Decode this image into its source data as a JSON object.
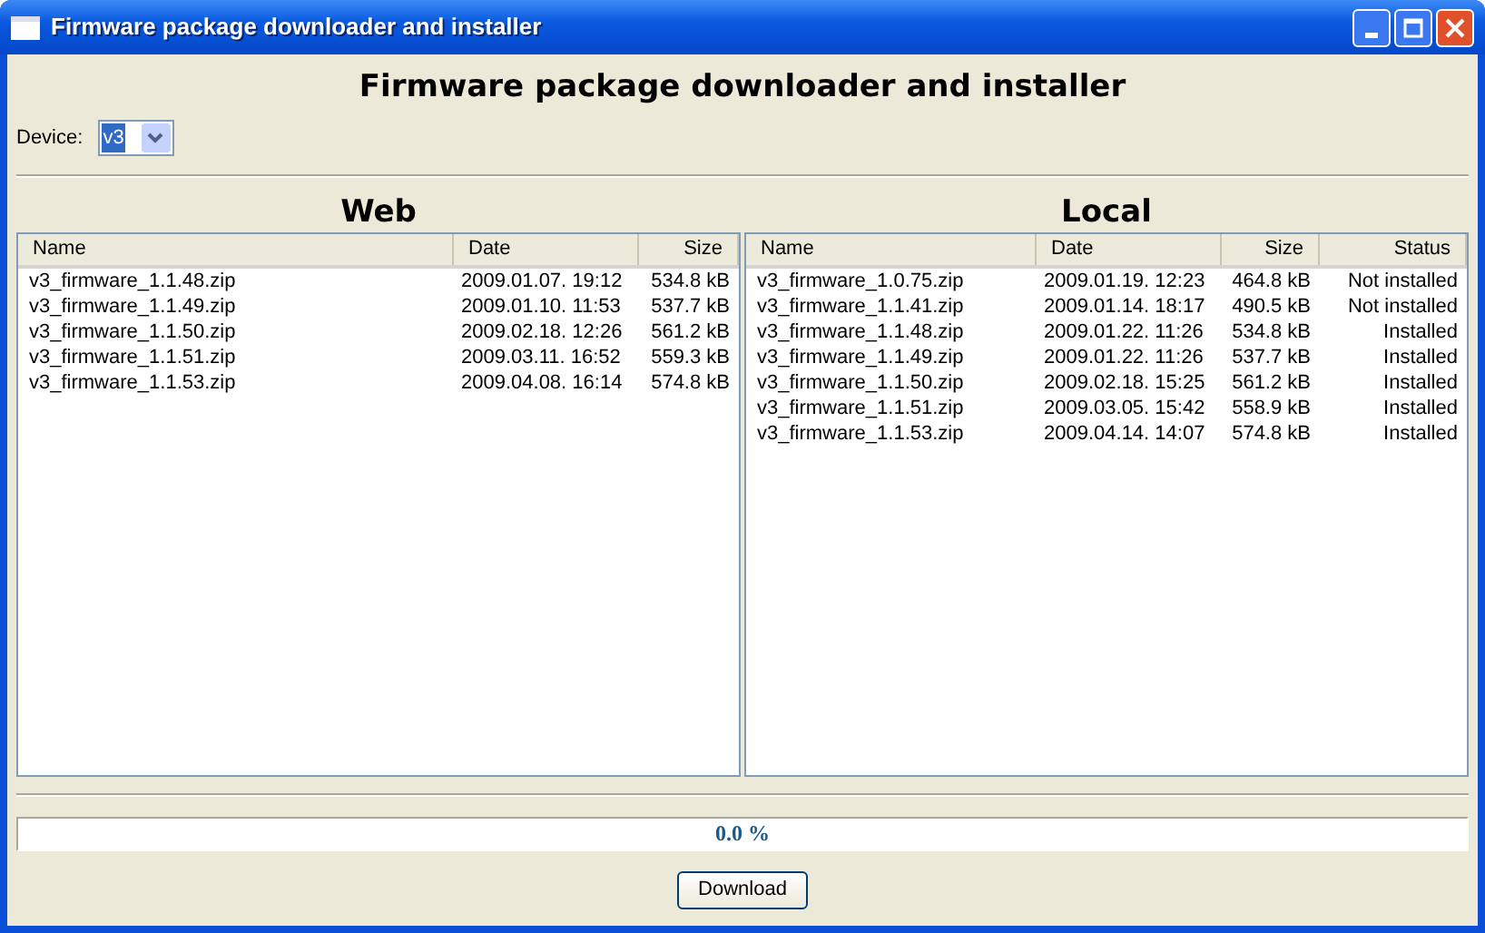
{
  "window": {
    "title": "Firmware package downloader and installer"
  },
  "heading": "Firmware package downloader and installer",
  "device": {
    "label": "Device:",
    "value": "v3"
  },
  "web": {
    "title": "Web",
    "columns": [
      "Name",
      "Date",
      "Size"
    ],
    "rows": [
      [
        "v3_firmware_1.1.48.zip",
        "2009.01.07. 19:12",
        "534.8 kB"
      ],
      [
        "v3_firmware_1.1.49.zip",
        "2009.01.10. 11:53",
        "537.7 kB"
      ],
      [
        "v3_firmware_1.1.50.zip",
        "2009.02.18. 12:26",
        "561.2 kB"
      ],
      [
        "v3_firmware_1.1.51.zip",
        "2009.03.11. 16:52",
        "559.3 kB"
      ],
      [
        "v3_firmware_1.1.53.zip",
        "2009.04.08. 16:14",
        "574.8 kB"
      ]
    ]
  },
  "local": {
    "title": "Local",
    "columns": [
      "Name",
      "Date",
      "Size",
      "Status"
    ],
    "rows": [
      [
        "v3_firmware_1.0.75.zip",
        "2009.01.19. 12:23",
        "464.8 kB",
        "Not installed"
      ],
      [
        "v3_firmware_1.1.41.zip",
        "2009.01.14. 18:17",
        "490.5 kB",
        "Not installed"
      ],
      [
        "v3_firmware_1.1.48.zip",
        "2009.01.22. 11:26",
        "534.8 kB",
        "Installed"
      ],
      [
        "v3_firmware_1.1.49.zip",
        "2009.01.22. 11:26",
        "537.7 kB",
        "Installed"
      ],
      [
        "v3_firmware_1.1.50.zip",
        "2009.02.18. 15:25",
        "561.2 kB",
        "Installed"
      ],
      [
        "v3_firmware_1.1.51.zip",
        "2009.03.05. 15:42",
        "558.9 kB",
        "Installed"
      ],
      [
        "v3_firmware_1.1.53.zip",
        "2009.04.14. 14:07",
        "574.8 kB",
        "Installed"
      ]
    ]
  },
  "progress": {
    "level": 0,
    "reading": "0.0 %"
  },
  "buttons": [
    "Download"
  ]
}
